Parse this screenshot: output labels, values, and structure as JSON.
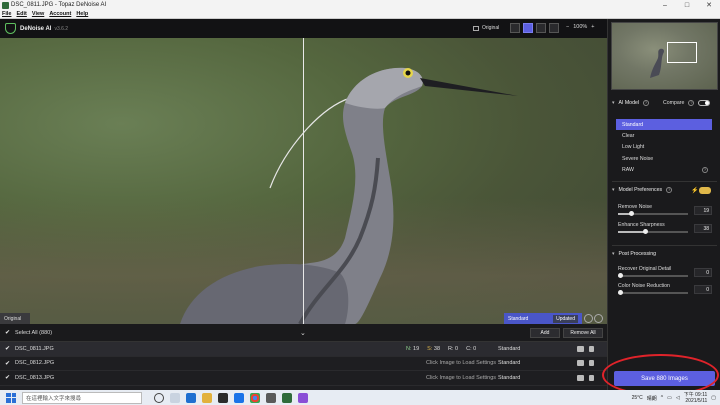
{
  "window": {
    "title": "DSC_0811.JPG - Topaz DeNoise AI",
    "minimize": "–",
    "maximize": "□",
    "close": "✕"
  },
  "menu": [
    "File",
    "Edit",
    "View",
    "Account",
    "Help"
  ],
  "app": {
    "name": "DeNoise AI",
    "version": "v3.6.2",
    "original_label": "Original",
    "zoom_minus": "−",
    "zoom_value": "100%",
    "zoom_plus": "+"
  },
  "viewer": {
    "label": "Original",
    "status_model": "Standard",
    "status_state": "Updated"
  },
  "list": {
    "select_all": "Select All (880)",
    "add_label": "Add",
    "remove_all_label": "Remove All",
    "rows": [
      {
        "name": "DSC_0811.JPG",
        "n_label": "N:",
        "n": "19",
        "s_label": "S:",
        "s": "38",
        "r_label": "R:",
        "r": "0",
        "c_label": "C:",
        "c": "0",
        "model": "Standard"
      },
      {
        "name": "DSC_0812.JPG",
        "hint": "Click Image to Load Settings",
        "model": "Standard"
      },
      {
        "name": "DSC_0813.JPG",
        "hint": "Click Image to Load Settings",
        "model": "Standard"
      }
    ]
  },
  "sidebar": {
    "ai_model_title": "AI Model",
    "compare_label": "Compare",
    "models": [
      "Standard",
      "Clear",
      "Low Light",
      "Severe Noise",
      "RAW"
    ],
    "model_prefs_title": "Model Preferences",
    "remove_noise_label": "Remove Noise",
    "remove_noise_value": "19",
    "enhance_sharpness_label": "Enhance Sharpness",
    "enhance_sharpness_value": "38",
    "post_processing_title": "Post Processing",
    "recover_detail_label": "Recover Original Detail",
    "recover_detail_value": "0",
    "color_noise_label": "Color Noise Reduction",
    "color_noise_value": "0",
    "save_label": "Save 880 Images"
  },
  "taskbar": {
    "search_placeholder": "在這裡輸入文字來搜尋",
    "temp": "25°C",
    "weather": "晴朗",
    "time": "下午 09:11",
    "date": "2021/5/11"
  },
  "colors": {
    "accent": "#5c5fe0",
    "annotation": "#e0232a",
    "toggle_on": "#e0b84a"
  },
  "slider_levels": {
    "remove_noise": 0.19,
    "enhance_sharpness": 0.38,
    "recover_detail": 0,
    "color_noise": 0
  }
}
